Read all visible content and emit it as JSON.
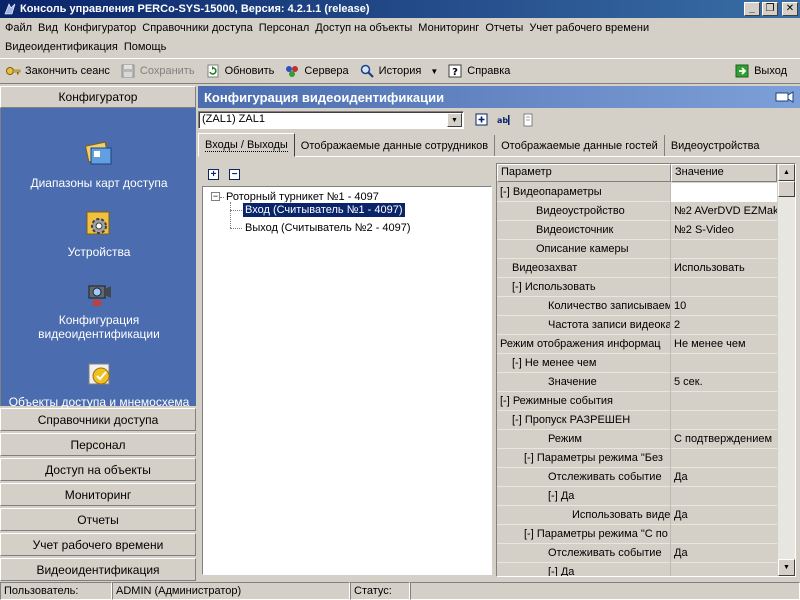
{
  "window": {
    "title": "Консоль управления PERCo-SYS-15000, Версия: 4.2.1.1 (release)",
    "controls": {
      "minimize": "_",
      "maximize": "❐",
      "close": "✕"
    }
  },
  "menu": {
    "row1": [
      "Файл",
      "Вид",
      "Конфигуратор",
      "Справочники доступа",
      "Персонал",
      "Доступ на объекты",
      "Мониторинг",
      "Отчеты",
      "Учет рабочего времени"
    ],
    "row2": [
      "Видеоидентификация",
      "Помощь"
    ]
  },
  "toolbar": {
    "end_session": "Закончить сеанс",
    "save": "Сохранить",
    "refresh": "Обновить",
    "servers": "Сервера",
    "history": "История",
    "help": "Справка",
    "exit": "Выход"
  },
  "leftnav": {
    "header": "Конфигуратор",
    "links": [
      {
        "label": "Диапазоны карт доступа"
      },
      {
        "label": "Устройства"
      },
      {
        "label": "Конфигурация видеоидентификации"
      },
      {
        "label": "Объекты доступа и мнемосхема"
      }
    ],
    "sections": [
      "Справочники доступа",
      "Персонал",
      "Доступ на объекты",
      "Мониторинг",
      "Отчеты",
      "Учет рабочего времени",
      "Видеоидентификация"
    ]
  },
  "main": {
    "title": "Конфигурация видеоидентификации",
    "combo_value": "(ZAL1) ZAL1",
    "tabs": [
      "Входы / Выходы",
      "Отображаемые данные сотрудников",
      "Отображаемые данные гостей",
      "Видеоустройства"
    ]
  },
  "tree": {
    "root": "Роторный турникет №1 - 4097",
    "children": [
      "Вход (Считыватель №1 - 4097)",
      "Выход (Считыватель №2 - 4097)"
    ]
  },
  "grid": {
    "col_param": "Параметр",
    "col_value": "Значение",
    "rows": [
      {
        "param": "[-] Видеопараметры",
        "value": "",
        "indent": 0,
        "white": true
      },
      {
        "param": "Видеоустройство",
        "value": "№2 AVerDVD EZMak",
        "indent": 3
      },
      {
        "param": "Видеоисточник",
        "value": "№2 S-Video",
        "indent": 3
      },
      {
        "param": "Описание камеры",
        "value": "",
        "indent": 3
      },
      {
        "param": "Видеозахват",
        "value": "Использовать",
        "indent": 1
      },
      {
        "param": "[-] Использовать",
        "value": "",
        "indent": 1
      },
      {
        "param": "Количество записываемы",
        "value": "10",
        "indent": 4
      },
      {
        "param": "Частота записи видеокадр",
        "value": "2",
        "indent": 4
      },
      {
        "param": "Режим отображения информац",
        "value": "Не менее чем",
        "indent": 0
      },
      {
        "param": "[-] Не менее чем",
        "value": "",
        "indent": 1
      },
      {
        "param": "Значение",
        "value": "5 сек.",
        "indent": 4
      },
      {
        "param": "[-] Режимные события",
        "value": "",
        "indent": 0
      },
      {
        "param": "[-] Пропуск РАЗРЕШЕН",
        "value": "",
        "indent": 1
      },
      {
        "param": "Режим",
        "value": "С подтверждением",
        "indent": 4
      },
      {
        "param": "[-] Параметры режима \"Без",
        "value": "",
        "indent": 2
      },
      {
        "param": "Отслеживать событие",
        "value": "Да",
        "indent": 4
      },
      {
        "param": "[-] Да",
        "value": "",
        "indent": 4
      },
      {
        "param": "Использовать виде",
        "value": "Да",
        "indent": 6
      },
      {
        "param": "[-] Параметры режима \"С по",
        "value": "",
        "indent": 2
      },
      {
        "param": "Отслеживать событие",
        "value": "Да",
        "indent": 4
      },
      {
        "param": "[-] Да",
        "value": "",
        "indent": 4
      }
    ]
  },
  "status": {
    "user_label": "Пользователь:",
    "user_value": "ADMIN (Администратор)",
    "status_label": "Статус:",
    "status_value": ""
  },
  "colors": {
    "nav_panel": "#4b6cae",
    "title_bar": "#0a246a",
    "selection": "#0a246a"
  }
}
